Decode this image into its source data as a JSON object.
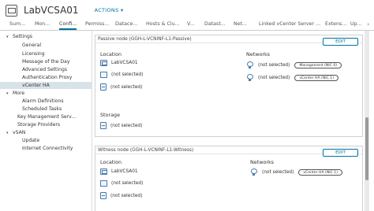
{
  "header": {
    "title": "LabVCSA01",
    "actions_label": "ACTIONS ▾"
  },
  "tabs": [
    "Sum...",
    "Mon...",
    "Confi...",
    "Permiss...",
    "Datace...",
    "Hosts & Clu...",
    "V...",
    "Datast...",
    "Net...",
    "Linked vCenter Server ...",
    "Extens...",
    "Up..."
  ],
  "tab_more": "›",
  "sidebar": {
    "items": [
      {
        "label": "Settings",
        "caret": "▾"
      },
      {
        "label": "General"
      },
      {
        "label": "Licensing"
      },
      {
        "label": "Message of the Day"
      },
      {
        "label": "Advanced Settings"
      },
      {
        "label": "Authentication Proxy"
      },
      {
        "label": "vCenter HA"
      },
      {
        "label": "More",
        "caret": "▾"
      },
      {
        "label": "Alarm Definitions"
      },
      {
        "label": "Scheduled Tasks"
      },
      {
        "label": "Key Management Serv..."
      },
      {
        "label": "Storage Providers"
      },
      {
        "label": "vSAN",
        "caret": "▾"
      },
      {
        "label": "Update"
      },
      {
        "label": "Internet Connectivity"
      }
    ]
  },
  "passive": {
    "title": "Passive node (GGH-L-VCNINF-L1-Passive)",
    "edit_label": "EDIT",
    "location_label": "Location",
    "networks_label": "Networks",
    "storage_label": "Storage",
    "vm": "LabVCSA01",
    "not_selected": "(not selected)",
    "nic1": "Management (NIC 0)",
    "nic2": "vCenter HA (NIC 1)"
  },
  "witness": {
    "title": "Witness node (GGH-L-VCNINF-L1-Witness)",
    "edit_label": "EDIT",
    "location_label": "Location",
    "networks_label": "Networks",
    "vm": "LabVCSA01",
    "not_selected": "(not selected)",
    "nic1": "vCenter HA (NIC 1)"
  }
}
